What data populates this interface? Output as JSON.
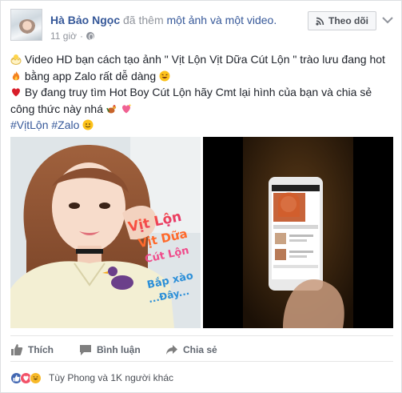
{
  "post": {
    "author": "Hà Bảo Ngọc",
    "action_prefix": "đã thêm",
    "action_link": "một ảnh và một video.",
    "timestamp": "11 giờ",
    "follow_label": "Theo dõi",
    "lines": [
      "Video HD bạn cách tạo ảnh \" Vịt Lộn Vịt Dữa Cút Lộn \" trào lưu đang hot",
      "bằng app Zalo rất dễ dàng",
      "By đang truy tìm Hot Boy Cút Lộn hãy Cmt lại hình của bạn và chia sẻ",
      "công thức này nhá"
    ],
    "hashtags": [
      "#VịtLộn",
      "#Zalo"
    ]
  },
  "media": {
    "sticker_lines": [
      "Vịt Lộn",
      "Vịt Dữa",
      "Cút Lộn",
      "Bắp xào",
      "...Đây..."
    ]
  },
  "actions": {
    "like": "Thích",
    "comment": "Bình luận",
    "share": "Chia sẻ"
  },
  "reactions": {
    "summary": "Tùy Phong và 1K người khác"
  },
  "colors": {
    "link": "#365899",
    "muted": "#90949c",
    "like_blue": "#4267b2",
    "love_red": "#f25268",
    "haha_yellow": "#f7b928"
  }
}
